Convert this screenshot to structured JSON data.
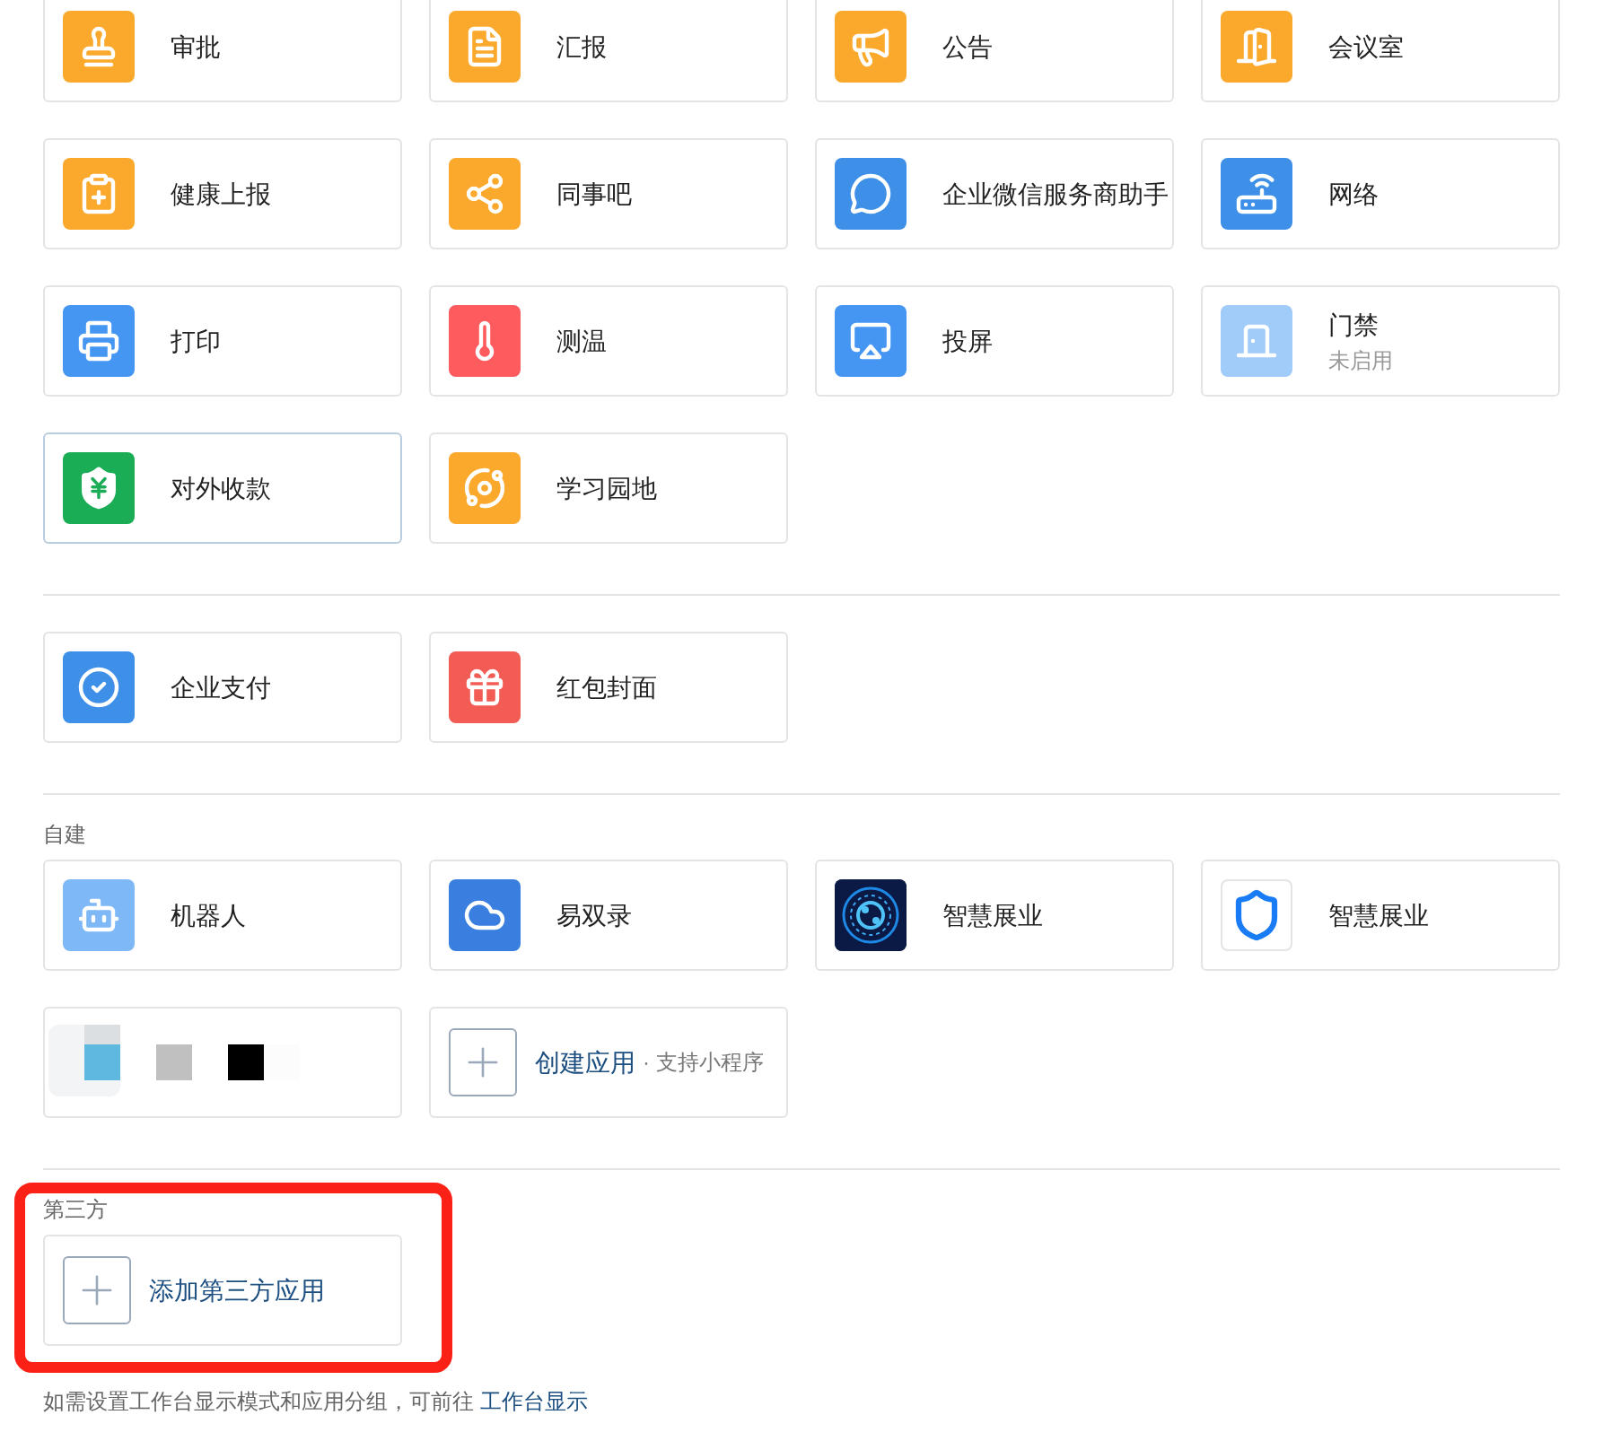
{
  "sections": [
    {
      "items": [
        {
          "kind": "app",
          "label": "审批",
          "color": "#fba92c",
          "selected": false,
          "disabled": false
        },
        {
          "kind": "app",
          "label": "汇报",
          "color": "#fba92c",
          "selected": false,
          "disabled": false
        },
        {
          "kind": "app",
          "label": "公告",
          "color": "#fba92c",
          "selected": false,
          "disabled": false
        },
        {
          "kind": "app",
          "label": "会议室",
          "color": "#fba92c",
          "selected": false,
          "disabled": false
        },
        {
          "kind": "app",
          "label": "健康上报",
          "color": "#fba92c",
          "selected": false,
          "disabled": false
        },
        {
          "kind": "app",
          "label": "同事吧",
          "color": "#fba92c",
          "selected": false,
          "disabled": false
        },
        {
          "kind": "app",
          "label": "企业微信服务商助手",
          "color": "#3d8fe8",
          "selected": false,
          "disabled": false
        },
        {
          "kind": "app",
          "label": "网络",
          "color": "#3d8fe8",
          "selected": false,
          "disabled": false
        },
        {
          "kind": "app",
          "label": "打印",
          "color": "#4596f3",
          "selected": false,
          "disabled": false
        },
        {
          "kind": "app",
          "label": "测温",
          "color": "#fd5b5e",
          "selected": false,
          "disabled": false
        },
        {
          "kind": "app",
          "label": "投屏",
          "color": "#4596f3",
          "selected": false,
          "disabled": false
        },
        {
          "kind": "app",
          "label": "门禁",
          "color": "#a1cbf8",
          "selected": false,
          "disabled": true,
          "status": "未启用"
        },
        {
          "kind": "app",
          "label": "对外收款",
          "color": "#1aad55",
          "selected": true,
          "disabled": false
        },
        {
          "kind": "app",
          "label": "学习园地",
          "color": "#fba92c",
          "selected": false,
          "disabled": false
        }
      ]
    },
    {
      "items": [
        {
          "kind": "app",
          "label": "企业支付",
          "color": "#3d8fe8",
          "selected": false,
          "disabled": false
        },
        {
          "kind": "app",
          "label": "红包封面",
          "color": "#f25c54",
          "selected": false,
          "disabled": false
        }
      ]
    },
    {
      "title": "自建",
      "items": [
        {
          "kind": "app",
          "label": "机器人",
          "color": "#7fb8f6",
          "selected": false,
          "disabled": false
        },
        {
          "kind": "app",
          "label": "易双录",
          "color": "#3a7fe0",
          "selected": false,
          "disabled": false
        },
        {
          "kind": "app",
          "label": "智慧展业",
          "color": "#0b1a45",
          "selected": false,
          "disabled": false
        },
        {
          "kind": "app",
          "label": "智慧展业",
          "color": "#ffffff",
          "selected": false,
          "disabled": false
        },
        {
          "kind": "obscured"
        },
        {
          "kind": "create",
          "label": "创建应用",
          "note": "· 支持小程序"
        }
      ]
    },
    {
      "highlighted": true,
      "title": "第三方",
      "items": [
        {
          "kind": "create",
          "label": "添加第三方应用"
        }
      ]
    }
  ],
  "footer": {
    "text": "如需设置工作台显示模式和应用分组，可前往",
    "link": "工作台显示"
  }
}
